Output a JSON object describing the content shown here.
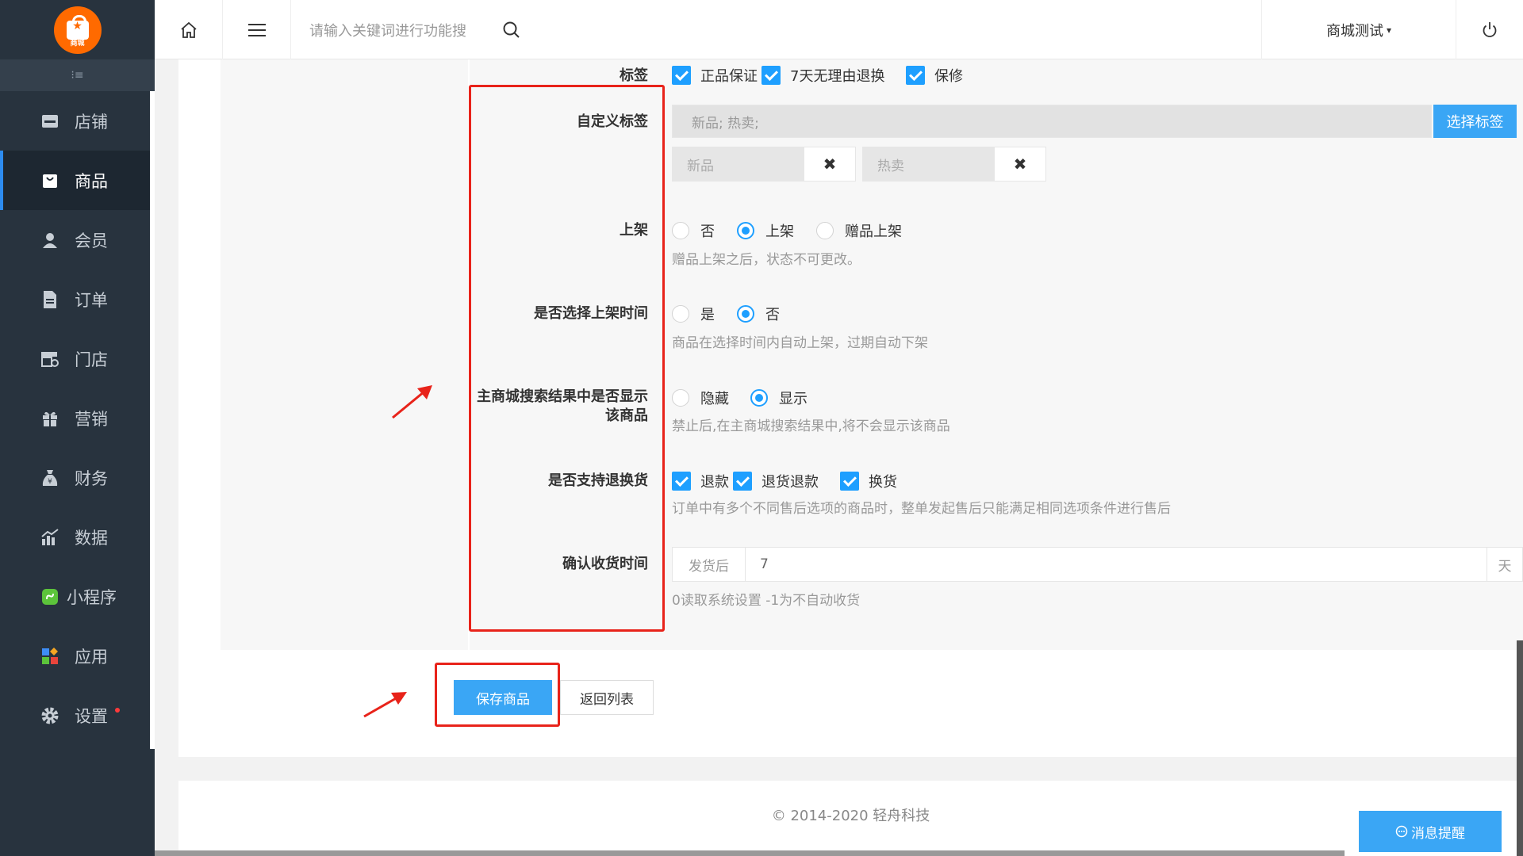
{
  "app": {
    "logo_text": "商城"
  },
  "sidebar": {
    "items": [
      {
        "label": "店铺",
        "icon": "store-icon"
      },
      {
        "label": "商品",
        "icon": "shopping-bag-icon"
      },
      {
        "label": "会员",
        "icon": "user-icon"
      },
      {
        "label": "订单",
        "icon": "document-icon"
      },
      {
        "label": "门店",
        "icon": "shop-settings-icon"
      },
      {
        "label": "营销",
        "icon": "gift-icon"
      },
      {
        "label": "财务",
        "icon": "money-bag-icon"
      },
      {
        "label": "数据",
        "icon": "bar-chart-icon"
      },
      {
        "label": "小程序",
        "icon": "mini-program-icon"
      },
      {
        "label": "应用",
        "icon": "apps-icon"
      },
      {
        "label": "设置",
        "icon": "gear-icon"
      }
    ],
    "active": "商品"
  },
  "header": {
    "search_placeholder": "请输入关键词进行功能搜",
    "store_name": "商城测试"
  },
  "form": {
    "tags": {
      "label": "标签",
      "options": [
        "正品保证",
        "7天无理由退换",
        "保修"
      ]
    },
    "custom_tags": {
      "label": "自定义标签",
      "placeholder": "新品; 热卖;",
      "button": "选择标签",
      "chips": [
        "新品",
        "热卖"
      ]
    },
    "on_shelf": {
      "label": "上架",
      "options": [
        "否",
        "上架",
        "赠品上架"
      ],
      "selected": "上架",
      "hint": "赠品上架之后，状态不可更改。"
    },
    "shelf_time": {
      "label": "是否选择上架时间",
      "options": [
        "是",
        "否"
      ],
      "selected": "否",
      "hint": "商品在选择时间内自动上架，过期自动下架"
    },
    "search_display": {
      "label_line1": "主商城搜索结果中是否显示",
      "label_line2": "该商品",
      "options": [
        "隐藏",
        "显示"
      ],
      "selected": "显示",
      "hint": "禁止后,在主商城搜索结果中,将不会显示该商品"
    },
    "returns": {
      "label": "是否支持退换货",
      "options": [
        "退款",
        "退货退款",
        "换货"
      ],
      "hint": "订单中有多个不同售后选项的商品时，整单发起售后只能满足相同选项条件进行售后"
    },
    "confirm_time": {
      "label": "确认收货时间",
      "prefix": "发货后",
      "value": "7",
      "suffix": "天",
      "hint": "0读取系统设置 -1为不自动收货"
    }
  },
  "actions": {
    "save": "保存商品",
    "back": "返回列表"
  },
  "footer": {
    "copyright": "© 2014-2020 轻舟科技",
    "message_button": "消息提醒"
  },
  "colors": {
    "accent": "#3aa6f5",
    "sidebar_bg": "#28333e",
    "annotation_red": "#e8231a"
  }
}
